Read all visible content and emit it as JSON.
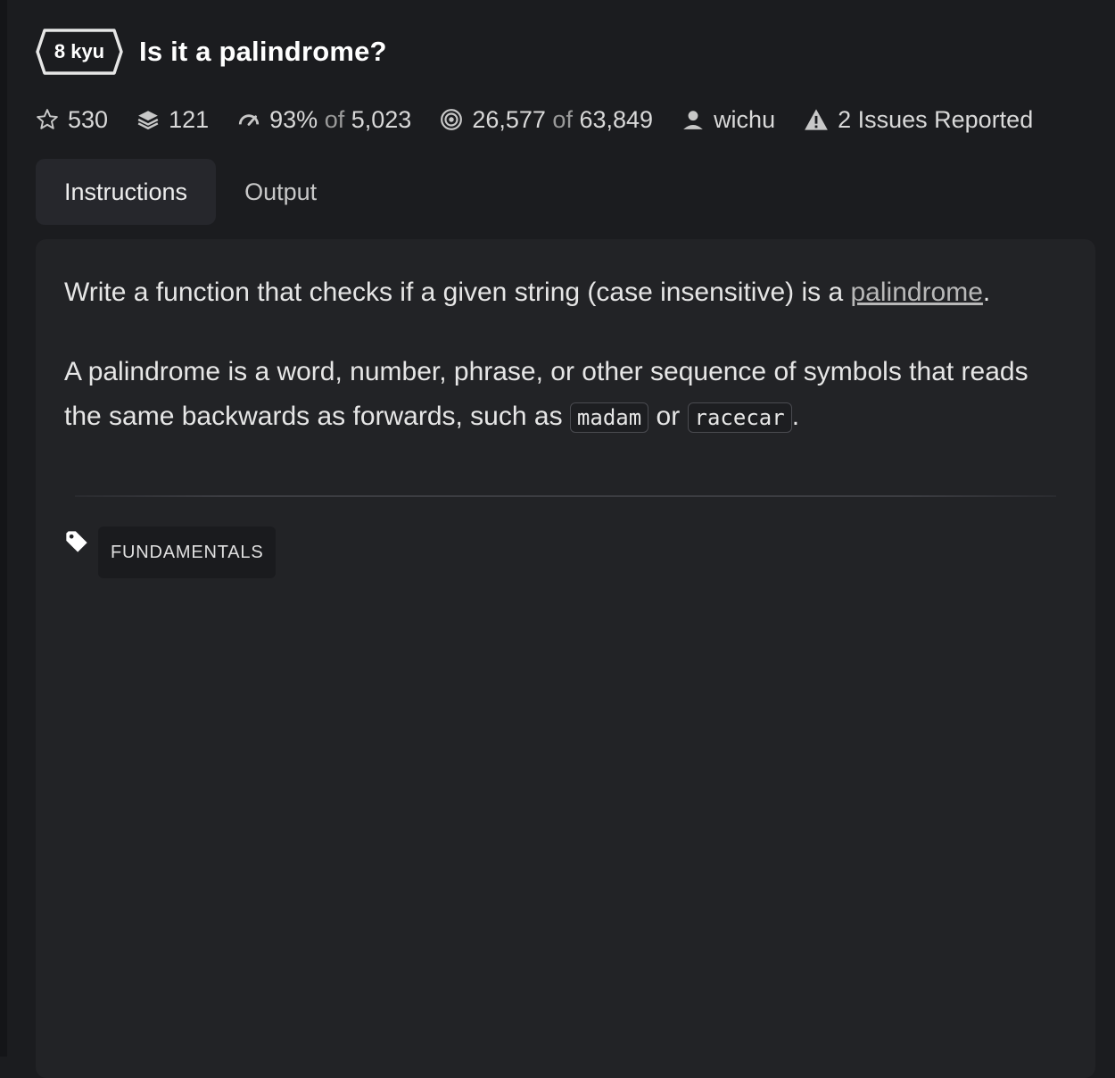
{
  "kata": {
    "rank": "8 kyu",
    "title": "Is it a palindrome?"
  },
  "stats": {
    "stars": "530",
    "collections": "121",
    "satisfaction_pct": "93%",
    "satisfaction_of": "of",
    "satisfaction_votes": "5,023",
    "completed": "26,577",
    "completed_of": "of",
    "attempted": "63,849",
    "author": "wichu",
    "issues": "2 Issues Reported"
  },
  "tabs": [
    {
      "label": "Instructions",
      "active": true
    },
    {
      "label": "Output",
      "active": false
    }
  ],
  "description": {
    "p1_text": "Write a function that checks if a given string (case insensitive) is a ",
    "p1_link": "palindrome",
    "p1_end": ".",
    "p2_text": "A palindrome is a word, number, phrase, or other sequence of symbols that reads the same backwards as forwards, such as ",
    "code1": "madam",
    "p2_or": " or ",
    "code2": "racecar",
    "p2_end": "."
  },
  "tags": [
    "FUNDAMENTALS"
  ],
  "colors": {
    "background": "#1b1c1f",
    "panel": "#222326",
    "active_tab": "#26272c",
    "text": "#e6e6e6",
    "muted": "#9a9a9a"
  },
  "icons": [
    "star-icon",
    "collections-icon",
    "gauge-icon",
    "target-icon",
    "user-icon",
    "warning-icon",
    "tag-icon"
  ]
}
